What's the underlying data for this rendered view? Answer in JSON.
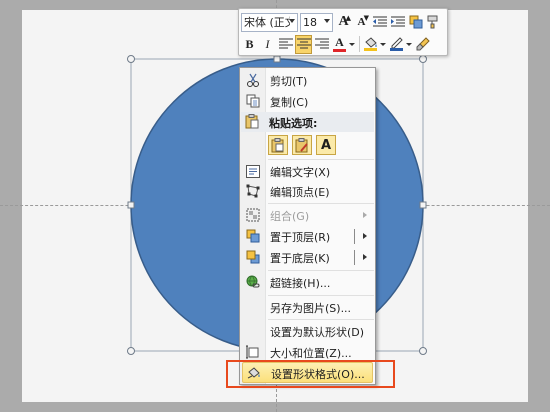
{
  "mini_toolbar": {
    "font_name": "宋体 (正文)",
    "font_size": "18",
    "buttons": [
      "grow-font",
      "shrink-font",
      "decrease-indent",
      "increase-indent",
      "bring-forward",
      "format-painter"
    ],
    "bold": "B",
    "italic": "I",
    "font_color": "A",
    "grow_font": "A",
    "shrink_font": "A"
  },
  "menu": {
    "cut": "剪切(T)",
    "copy": "复制(C)",
    "paste_options": "粘贴选项:",
    "paste_text_only": "A",
    "edit_text": "编辑文字(X)",
    "edit_points": "编辑顶点(E)",
    "group": "组合(G)",
    "bring_to_front": "置于顶层(R)",
    "send_to_back": "置于底层(K)",
    "hyperlink": "超链接(H)...",
    "save_as_picture": "另存为图片(S)...",
    "set_default_shape": "设置为默认形状(D)",
    "size_position": "大小和位置(Z)...",
    "format_shape": "设置形状格式(O)..."
  },
  "colors": {
    "shape_fill": "#4f81bd",
    "shape_stroke": "#385d8a",
    "highlight_border": "#e8491d",
    "menu_hover": "#fbe07a"
  }
}
